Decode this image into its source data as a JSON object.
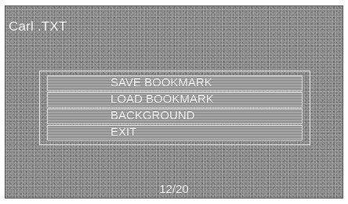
{
  "screen": {
    "title": "Carl .TXT"
  },
  "menu": {
    "items": [
      {
        "label": "SAVE BOOKMARK"
      },
      {
        "label": "LOAD BOOKMARK"
      },
      {
        "label": "BACKGROUND"
      },
      {
        "label": "EXIT"
      }
    ]
  },
  "footer": {
    "page_indicator": "12/20"
  }
}
